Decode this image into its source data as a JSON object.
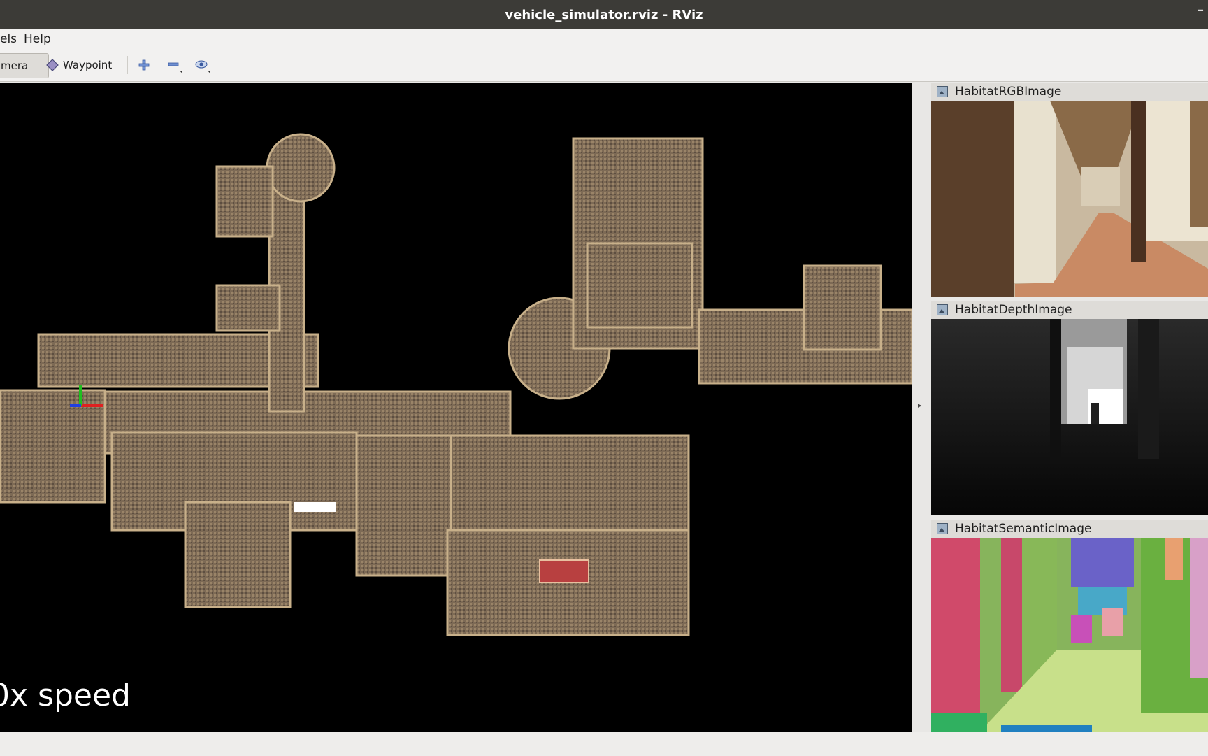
{
  "window": {
    "title": "vehicle_simulator.rviz - RViz",
    "minimize_glyph": "–"
  },
  "menu": {
    "items": [
      {
        "label": "els"
      },
      {
        "label": "Help"
      }
    ]
  },
  "toolbar": {
    "tools": [
      {
        "label": "mera",
        "active": true
      },
      {
        "label": "Waypoint",
        "icon": "diamond-icon"
      }
    ],
    "buttons": [
      {
        "icon": "add-icon"
      },
      {
        "icon": "minus-icon"
      },
      {
        "icon": "eye-icon"
      }
    ]
  },
  "viewport": {
    "overlay_text": "0x speed"
  },
  "panels": [
    {
      "title": "HabitatRGBImage"
    },
    {
      "title": "HabitatDepthImage"
    },
    {
      "title": "HabitatSemanticImage"
    }
  ],
  "colors": {
    "titlebar": "#3c3b37",
    "viewport_background": "#000000",
    "map_floor": "#8a7358",
    "axis_x": "#e02020",
    "axis_y": "#20c020",
    "axis_z": "#2040e0"
  }
}
